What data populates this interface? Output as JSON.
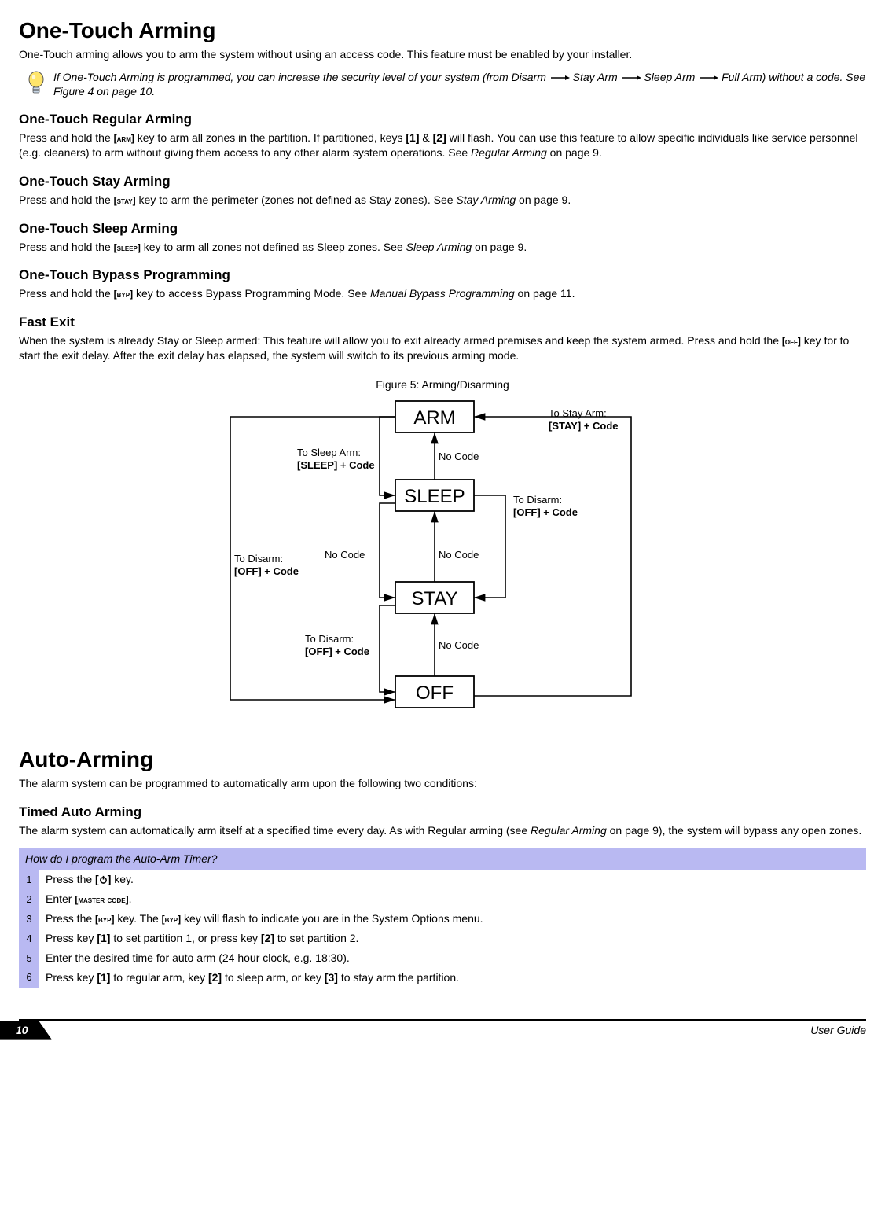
{
  "h1_onetouch": "One-Touch Arming",
  "p_onetouch_intro": "One-Touch arming allows you to arm the system without using an access code. This feature must be enabled by your installer.",
  "note_prefix": "If One-Touch Arming is programmed, you can increase the security level of your system (from Disarm",
  "note_seg1": "Stay Arm",
  "note_seg2": "Sleep Arm",
  "note_seg3": "Full Arm) without a code. See Figure 4 on page 10.",
  "h2_regular": "One-Touch Regular Arming",
  "p_regular_a": "Press and hold the ",
  "key_arm": "[arm]",
  "p_regular_b": " key  to arm all zones in the partition. If partitioned, keys ",
  "key_1": "[1]",
  "p_regular_c": " & ",
  "key_2": "[2]",
  "p_regular_d": " will flash. You can use this feature to allow specific individuals like service personnel (e.g. cleaners) to arm without giving them access to any other alarm system operations. See ",
  "ref_regular": "Regular Arming",
  "p_regular_e": " on page 9.",
  "h2_stay": "One-Touch Stay Arming",
  "p_stay_a": "Press and hold the ",
  "key_stay": "[stay]",
  "p_stay_b": " key to arm the perimeter (zones not defined as Stay zones). See ",
  "ref_stay": "Stay Arming",
  "p_stay_c": " on page 9.",
  "h2_sleep": "One-Touch Sleep Arming",
  "p_sleep_a": "Press and hold the ",
  "key_sleep": "[sleep]",
  "p_sleep_b": " key to arm all zones not defined as Sleep zones. See ",
  "ref_sleep": "Sleep Arming",
  "p_sleep_c": " on page 9.",
  "h2_bypass": "One-Touch Bypass Programming",
  "p_bypass_a": "Press and hold the ",
  "key_byp": "[byp]",
  "p_bypass_b": " key to access Bypass Programming Mode. See ",
  "ref_bypass": "Manual Bypass Programming",
  "p_bypass_c": " on page 11.",
  "h2_fastexit": "Fast Exit",
  "p_fastexit_a": "When the system is already Stay or Sleep armed: This feature will allow you to exit already armed premises and keep the system armed. Press and hold the ",
  "key_off": "[off]",
  "p_fastexit_b": " key for  to start the exit delay. After the exit delay has elapsed, the system will switch to its previous arming mode.",
  "fig_caption": "Figure 5: Arming/Disarming",
  "diagram": {
    "box_arm": "ARM",
    "box_sleep": "SLEEP",
    "box_stay": "STAY",
    "box_off": "OFF",
    "to_sleep_arm_l1": "To Sleep Arm:",
    "to_sleep_arm_l2": "[SLEEP] + Code",
    "to_disarm_l1": "To Disarm:",
    "to_disarm_l2": "[OFF] + Code",
    "to_stay_arm_l1": "To Stay Arm:",
    "to_stay_arm_l2": "[STAY] + Code",
    "no_code": "No Code"
  },
  "h1_auto": "Auto-Arming",
  "p_auto_intro": "The alarm system can be programmed to automatically arm upon the following two conditions:",
  "h2_timed": "Timed Auto Arming",
  "p_timed_a": "The alarm system can automatically arm itself at a specified time every day. As with Regular arming (see ",
  "ref_timed": "Regular Arming",
  "p_timed_b": " on page 9), the system will bypass any open zones.",
  "howto": {
    "title": "How do I program the Auto-Arm Timer?",
    "steps": [
      {
        "n": "1",
        "a": "Press the ",
        "b": " key."
      },
      {
        "n": "2",
        "a": "Enter ",
        "key": "[master code]",
        "b": "."
      },
      {
        "n": "3",
        "a": "Press the ",
        "key": "[byp]",
        "mid": " key. The ",
        "key2": "[byp]",
        "b": " key will flash to indicate you are in the System Options menu."
      },
      {
        "n": "4",
        "a": "Press key ",
        "key": "[1]",
        "mid": " to set partition 1, or press key ",
        "key2": "[2]",
        "b": " to set partition 2."
      },
      {
        "n": "5",
        "a": "Enter the desired time for auto arm (24 hour clock, e.g. 18:30).",
        "b": ""
      },
      {
        "n": "6",
        "a": "Press key ",
        "key": "[1]",
        "mid": " to regular arm, key ",
        "key2": "[2]",
        "mid2": " to sleep arm, or key ",
        "key3": "[3]",
        "b": " to stay arm the partition."
      }
    ]
  },
  "footer_page": "10",
  "footer_right": "User Guide"
}
